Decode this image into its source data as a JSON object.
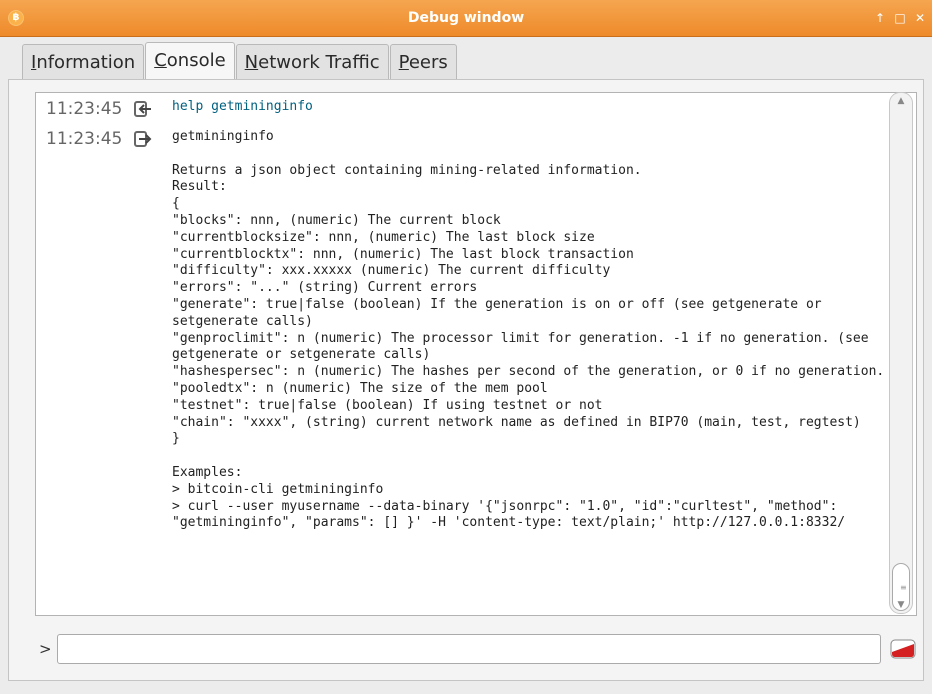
{
  "window": {
    "title": "Debug window",
    "app_icon": "bitcoin-icon",
    "controls": [
      {
        "name": "keep-above-icon",
        "glyph": "↑"
      },
      {
        "name": "maximize-icon",
        "glyph": "□"
      },
      {
        "name": "close-icon",
        "glyph": "✕"
      }
    ]
  },
  "tabs": [
    {
      "pre": "",
      "ul": "I",
      "post": "nformation",
      "active": false
    },
    {
      "pre": "",
      "ul": "C",
      "post": "onsole",
      "active": true
    },
    {
      "pre": "",
      "ul": "N",
      "post": "etwork Traffic",
      "active": false
    },
    {
      "pre": "",
      "ul": "P",
      "post": "eers",
      "active": false
    }
  ],
  "console": {
    "entries": [
      {
        "time": "11:23:45",
        "icon": "command-arrow-in-icon",
        "text": "help getmininginfo"
      },
      {
        "time": "11:23:45",
        "icon": "reply-arrow-out-icon",
        "text": "getmininginfo\n\nReturns a json object containing mining-related information.\nResult:\n{\n\"blocks\": nnn, (numeric) The current block\n\"currentblocksize\": nnn, (numeric) The last block size\n\"currentblocktx\": nnn, (numeric) The last block transaction\n\"difficulty\": xxx.xxxxx (numeric) The current difficulty\n\"errors\": \"...\" (string) Current errors\n\"generate\": true|false (boolean) If the generation is on or off (see getgenerate or setgenerate calls)\n\"genproclimit\": n (numeric) The processor limit for generation. -1 if no generation. (see getgenerate or setgenerate calls)\n\"hashespersec\": n (numeric) The hashes per second of the generation, or 0 if no generation.\n\"pooledtx\": n (numeric) The size of the mem pool\n\"testnet\": true|false (boolean) If using testnet or not\n\"chain\": \"xxxx\", (string) current network name as defined in BIP70 (main, test, regtest)\n}\n\nExamples:\n> bitcoin-cli getmininginfo\n> curl --user myusername --data-binary '{\"jsonrpc\": \"1.0\", \"id\":\"curltest\", \"method\": \"getmininginfo\", \"params\": [] }' -H 'content-type: text/plain;' http://127.0.0.1:8332/"
      }
    ],
    "prompt": ">",
    "input_value": "",
    "clear_icon": "clear-console-icon",
    "scroll_position": 1.0
  }
}
